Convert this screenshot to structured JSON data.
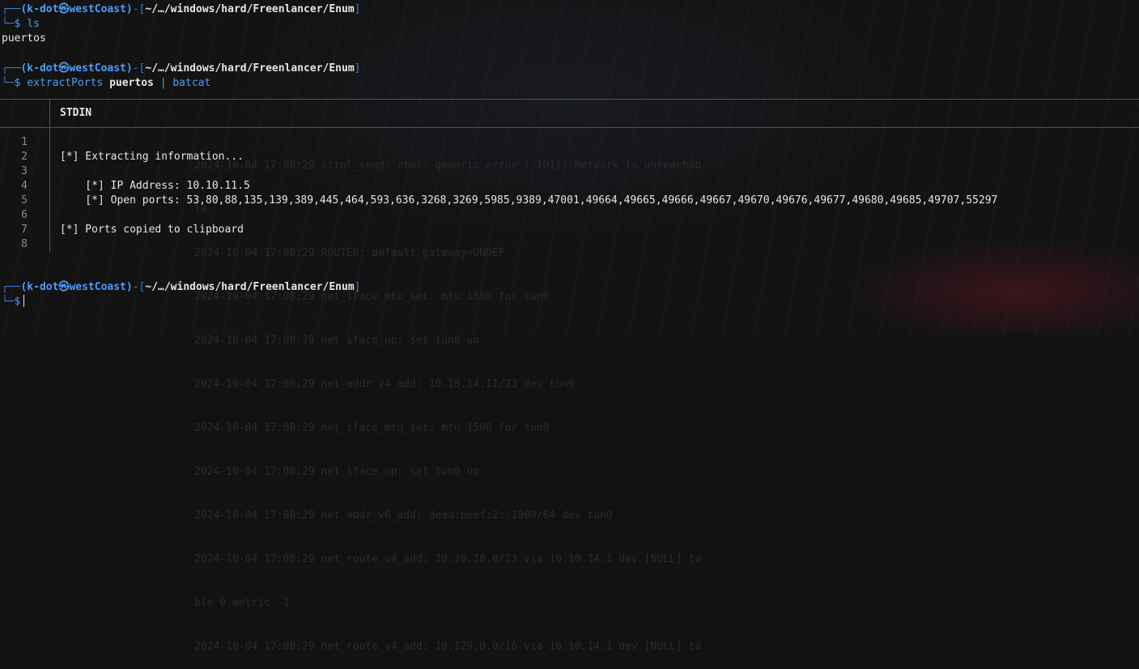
{
  "prompt": {
    "user": "(k-dot㉿westCoast)",
    "path": "~/…/windows/hard/Freenlancer/Enum"
  },
  "commands": {
    "first": "ls",
    "second_main": "extractPorts",
    "second_arg": "puertos",
    "second_pipe": "| batcat"
  },
  "ls_output": "puertos",
  "batcat": {
    "header": "STDIN",
    "line_numbers": [
      "1",
      "2",
      "3",
      "4",
      "5",
      "6",
      "7",
      "8"
    ],
    "lines": [
      "",
      "[*] Extracting information...",
      "",
      "    [*] IP Address: 10.10.11.5",
      "    [*] Open ports: 53,80,88,135,139,389,445,464,593,636,3268,3269,5985,9389,47001,49664,49665,49666,49667,49670,49676,49677,49680,49685,49707,55297",
      "",
      "[*] Ports copied to clipboard",
      ""
    ]
  },
  "background_log": [
    "2024-10-04 17:08:29 sitnl_send: rtnl: generic error (-101): Network is unreachab",
    "le",
    "2024-10-04 17:08:29 ROUTE6: default_gateway=UNDEF",
    "2024-10-04 17:08:29 net_iface_mtu_set: mtu 1500 for tun0",
    "2024-10-04 17:08:29 net_iface_up: set tun0 up",
    "2024-10-04 17:08:29 net_addr_v4_add: 10.10.14.11/23 dev tun0",
    "2024-10-04 17:08:29 net_iface_mtu_set: mtu 1500 for tun0",
    "2024-10-04 17:08:29 net_iface_up: set tun0 up",
    "2024-10-04 17:08:29 net_addr_v6_add: dead:beef:2::1009/64 dev tun0",
    "2024-10-04 17:08:29 net_route_v4_add: 10.10.10.0/23 via 10.10.14.1 dev [NULL] ta",
    "ble 0 metric -1",
    "2024-10-04 17:08:29 net_route_v4_add: 10.129.0.0/16 via 10.10.14.1 dev [NULL] ta"
  ],
  "colors": {
    "prompt_frame": "#3a7bd5",
    "prompt_user": "#4d9df8",
    "text": "#e6e6e6",
    "line_number": "#8a8a8a",
    "background": "#121212"
  }
}
